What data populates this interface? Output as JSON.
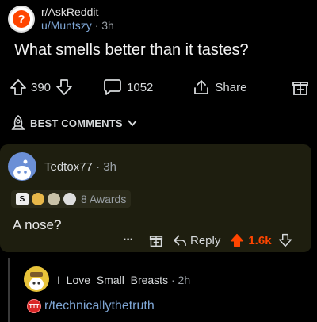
{
  "post": {
    "subreddit": "r/AskReddit",
    "user_prefix": "u/",
    "username": "Muntszy",
    "separator": "·",
    "age": "3h",
    "avatar_glyph": "?",
    "title": "What smells better than it tastes?",
    "score": "390",
    "comments_count": "1052",
    "share_label": "Share"
  },
  "sort": {
    "label": "BEST COMMENTS"
  },
  "comment": {
    "author": "Tedtox77",
    "separator": "·",
    "age": "3h",
    "awards_label": "8 Awards",
    "award_glyph_1": "S",
    "body": "A nose?",
    "more_label": "···",
    "reply_label": "Reply",
    "score": "1.6k"
  },
  "reply": {
    "author": "I_Love_Small_Breasts",
    "separator": "·",
    "age": "2h",
    "flair_glyph": "TTT",
    "flair_text": "r/technicallythetruth"
  },
  "colors": {
    "accent": "#ff4500",
    "link": "#7fa7d6",
    "card_bg": "#1e1e0f"
  },
  "icons": [
    "question-icon",
    "upvote-icon",
    "downvote-icon",
    "comment-icon",
    "share-icon",
    "award-icon",
    "rocket-icon",
    "chevron-down-icon",
    "reply-icon"
  ]
}
